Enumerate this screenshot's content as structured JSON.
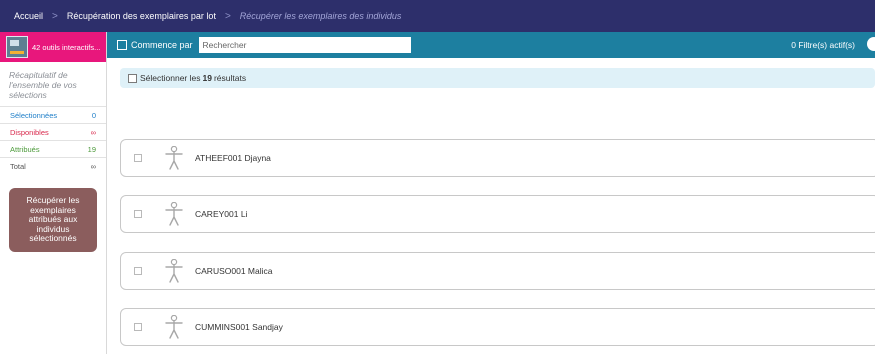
{
  "breadcrumb": {
    "home": "Accueil",
    "section": "Récupération des exemplaires par lot",
    "current": "Récupérer les exemplaires des individus",
    "separator": ">"
  },
  "sidebar": {
    "tools_label": "42 outils interactifs...",
    "summary": "Récapitulatif de l'ensemble de vos sélections",
    "stats": [
      {
        "label": "Sélectionnées",
        "value": "0"
      },
      {
        "label": "Disponibles",
        "value": "∞"
      },
      {
        "label": "Attribués",
        "value": "19"
      },
      {
        "label": "Total",
        "value": "∞"
      }
    ],
    "recover_button": "Récupérer les exemplaires attribués aux individus sélectionnés"
  },
  "filterbar": {
    "starts_with_label": "Commence par",
    "search_placeholder": "Rechercher",
    "filters_count": "0 Filtre(s) actif(s)"
  },
  "select_all": {
    "prefix": "Sélectionner les",
    "count": "19",
    "suffix": "résultats"
  },
  "results": [
    {
      "name": "ATHEEF001 Djayna"
    },
    {
      "name": "CAREY001 Li"
    },
    {
      "name": "CARUSO001 Malica"
    },
    {
      "name": "CUMMINS001 Sandjay"
    }
  ],
  "colors": {
    "topbar": "#2d2f6b",
    "filterbar": "#1d7fa0",
    "tools_banner": "#e8177c",
    "recover_button": "#8b5d5d",
    "selected": "#1e7ec8",
    "available": "#d8284b",
    "assigned": "#4c9a3a"
  }
}
